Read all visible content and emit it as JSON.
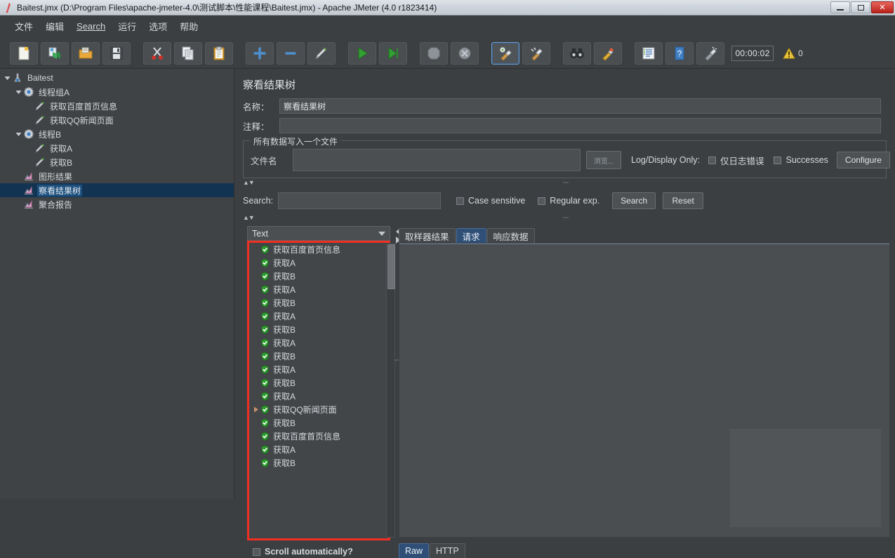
{
  "window": {
    "title": "Baitest.jmx (D:\\Program Files\\apache-jmeter-4.0\\测试脚本\\性能课程\\Baitest.jmx) - Apache JMeter (4.0 r1823414)",
    "minimize": "—",
    "maximize": "❐",
    "close": "✕"
  },
  "menu": [
    {
      "label": "文件"
    },
    {
      "label": "编辑"
    },
    {
      "label": "Search"
    },
    {
      "label": "运行"
    },
    {
      "label": "选项"
    },
    {
      "label": "帮助"
    }
  ],
  "toolbar": {
    "buttons": [
      {
        "name": "new",
        "icon": "new-file-icon"
      },
      {
        "name": "templates",
        "icon": "templates-icon"
      },
      {
        "name": "open",
        "icon": "open-folder-icon"
      },
      {
        "name": "save",
        "icon": "save-icon"
      },
      {
        "name": "cut",
        "icon": "scissors-icon"
      },
      {
        "name": "copy",
        "icon": "copy-icon"
      },
      {
        "name": "paste",
        "icon": "clipboard-icon"
      },
      {
        "name": "expand-all",
        "icon": "plus-icon"
      },
      {
        "name": "collapse-all",
        "icon": "minus-icon"
      },
      {
        "name": "toggle",
        "icon": "toggle-pencil-icon"
      },
      {
        "name": "start",
        "icon": "play-green-icon"
      },
      {
        "name": "start-no-pauses",
        "icon": "play-no-pause-icon"
      },
      {
        "name": "stop",
        "icon": "stop-icon"
      },
      {
        "name": "shutdown",
        "icon": "shutdown-icon"
      },
      {
        "name": "clear",
        "icon": "clear-broom-icon"
      },
      {
        "name": "clear-all",
        "icon": "clear-all-broom-icon"
      },
      {
        "name": "search",
        "icon": "binoculars-icon"
      },
      {
        "name": "reset-search",
        "icon": "reset-search-icon"
      },
      {
        "name": "function-helper",
        "icon": "list-icon"
      },
      {
        "name": "help",
        "icon": "help-question-icon"
      },
      {
        "name": "undo-clear",
        "icon": "clear-gui-icon"
      }
    ],
    "timer": "00:00:02",
    "warning_count": "0"
  },
  "tree": {
    "nodes": [
      {
        "label": "Baitest",
        "icon": "test-plan-icon",
        "depth": 0,
        "twisty": "down",
        "selected": false
      },
      {
        "label": "线程组A",
        "icon": "thread-group-icon",
        "depth": 1,
        "twisty": "down",
        "selected": false
      },
      {
        "label": "获取百度首页信息",
        "icon": "http-sampler-icon",
        "depth": 2,
        "twisty": "none",
        "selected": false
      },
      {
        "label": "获取QQ新闻页面",
        "icon": "http-sampler-icon",
        "depth": 2,
        "twisty": "none",
        "selected": false
      },
      {
        "label": "线程B",
        "icon": "thread-group-icon",
        "depth": 1,
        "twisty": "down",
        "selected": false
      },
      {
        "label": "获取A",
        "icon": "http-sampler-icon",
        "depth": 2,
        "twisty": "none",
        "selected": false
      },
      {
        "label": "获取B",
        "icon": "http-sampler-icon",
        "depth": 2,
        "twisty": "none",
        "selected": false
      },
      {
        "label": "图形结果",
        "icon": "listener-icon",
        "depth": 1,
        "twisty": "none",
        "selected": false
      },
      {
        "label": "察看结果树",
        "icon": "listener-icon",
        "depth": 1,
        "twisty": "none",
        "selected": true
      },
      {
        "label": "聚合报告",
        "icon": "listener-icon",
        "depth": 1,
        "twisty": "none",
        "selected": false
      }
    ]
  },
  "panel": {
    "title": "察看结果树",
    "name_label": "名称：",
    "name_value": "察看结果树",
    "comment_label": "注释：",
    "comment_value": "",
    "file_group_legend": "所有数据写入一个文件",
    "filename_label": "文件名",
    "filename_value": "",
    "browse_label": "浏览...",
    "logdisplay_label": "Log/Display Only:",
    "errors_only_label": "仅日志错误",
    "successes_label": "Successes",
    "configure_label": "Configure",
    "search_label": "Search:",
    "search_value": "",
    "case_sensitive_label": "Case sensitive",
    "regular_exp_label": "Regular exp.",
    "search_button": "Search",
    "reset_button": "Reset",
    "render_selected": "Text",
    "scroll_auto_label": "Scroll automatically?"
  },
  "results": {
    "items": [
      {
        "label": "获取百度首页信息",
        "status": "success",
        "expandable": false
      },
      {
        "label": "获取A",
        "status": "success",
        "expandable": false
      },
      {
        "label": "获取B",
        "status": "success",
        "expandable": false
      },
      {
        "label": "获取A",
        "status": "success",
        "expandable": false
      },
      {
        "label": "获取B",
        "status": "success",
        "expandable": false
      },
      {
        "label": "获取A",
        "status": "success",
        "expandable": false
      },
      {
        "label": "获取B",
        "status": "success",
        "expandable": false
      },
      {
        "label": "获取A",
        "status": "success",
        "expandable": false
      },
      {
        "label": "获取B",
        "status": "success",
        "expandable": false
      },
      {
        "label": "获取A",
        "status": "success",
        "expandable": false
      },
      {
        "label": "获取B",
        "status": "success",
        "expandable": false
      },
      {
        "label": "获取A",
        "status": "success",
        "expandable": false
      },
      {
        "label": "获取QQ新闻页面",
        "status": "success",
        "expandable": true
      },
      {
        "label": "获取B",
        "status": "success",
        "expandable": false
      },
      {
        "label": "获取百度首页信息",
        "status": "success",
        "expandable": false
      },
      {
        "label": "获取A",
        "status": "success",
        "expandable": false
      },
      {
        "label": "获取B",
        "status": "success",
        "expandable": false
      }
    ]
  },
  "detail": {
    "tabs": [
      {
        "label": "取样器结果",
        "active": false
      },
      {
        "label": "请求",
        "active": true
      },
      {
        "label": "响应数据",
        "active": false
      }
    ],
    "subtabs": [
      {
        "label": "Raw",
        "active": true
      },
      {
        "label": "HTTP",
        "active": false
      }
    ],
    "content": ""
  },
  "colors": {
    "accent": "#2f4f77",
    "highlight_border": "#ee2f22",
    "success": "#3faa3f",
    "bg": "#3c3f41",
    "tree_selected": "#1d4f7d"
  }
}
